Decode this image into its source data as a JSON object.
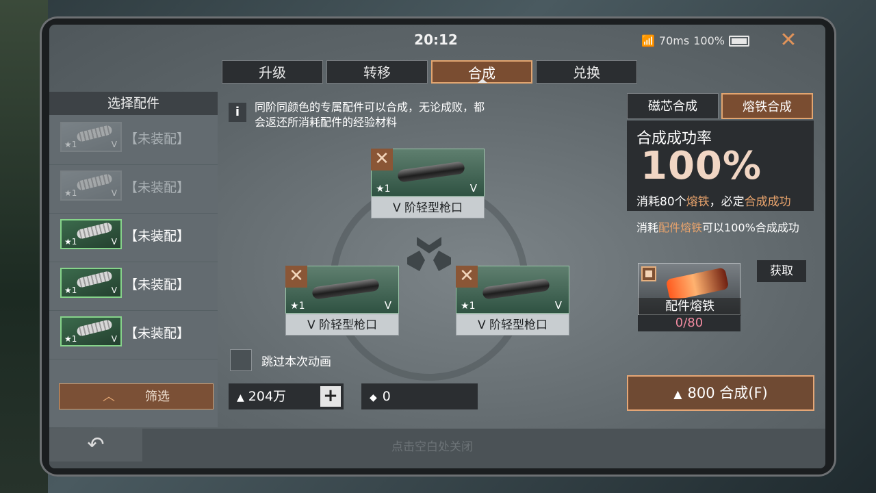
{
  "status": {
    "clock": "20:12",
    "ping": "70ms",
    "battery": "100%"
  },
  "tabs": [
    "升级",
    "转移",
    "合成",
    "兑换"
  ],
  "active_tab": 2,
  "left_panel": {
    "title": "选择配件",
    "items": [
      {
        "star": "1",
        "grade": "V",
        "label": "【未装配】",
        "state": "dimmed"
      },
      {
        "star": "1",
        "grade": "V",
        "label": "【未装配】",
        "state": "dimmed"
      },
      {
        "star": "1",
        "grade": "V",
        "label": "【未装配】",
        "state": "normal"
      },
      {
        "star": "1",
        "grade": "V",
        "label": "【未装配】",
        "state": "normal"
      },
      {
        "star": "1",
        "grade": "V",
        "label": "【未装配】",
        "state": "normal"
      }
    ],
    "filter_label": "筛选"
  },
  "info": {
    "icon": "i",
    "text_line1": "同阶同颜色的专属配件可以合成，无论成败，都",
    "text_line2": "会返还所消耗配件的经验材料"
  },
  "cards": [
    {
      "star": "1",
      "grade": "V",
      "name": "V 阶轻型枪口"
    },
    {
      "star": "1",
      "grade": "V",
      "name": "V 阶轻型枪口"
    },
    {
      "star": "1",
      "grade": "V",
      "name": "V 阶轻型枪口"
    }
  ],
  "skip_animation_label": "跳过本次动画",
  "currency": {
    "gold": "204万",
    "ticket": "0"
  },
  "right_panel": {
    "tabs": [
      "磁芯合成",
      "熔铁合成"
    ],
    "rate_title": "合成成功率",
    "rate_value": "100%",
    "rate_desc_a": "消耗80个",
    "rate_desc_b": "熔铁",
    "rate_desc_c": "，必定",
    "rate_desc_d": "合成成功",
    "note_a": "消耗",
    "note_b": "配件熔铁",
    "note_c": "可以100%合成成功",
    "material_name": "配件熔铁",
    "material_count": "0/80",
    "get_label": "获取",
    "synth_label": "800 合成(F)"
  },
  "bottom": {
    "hint": "点击空白处关闭"
  },
  "colors": {
    "accent": "#e2a570",
    "active_tab": "#7a4d31",
    "count_pink": "#f08aa0"
  }
}
